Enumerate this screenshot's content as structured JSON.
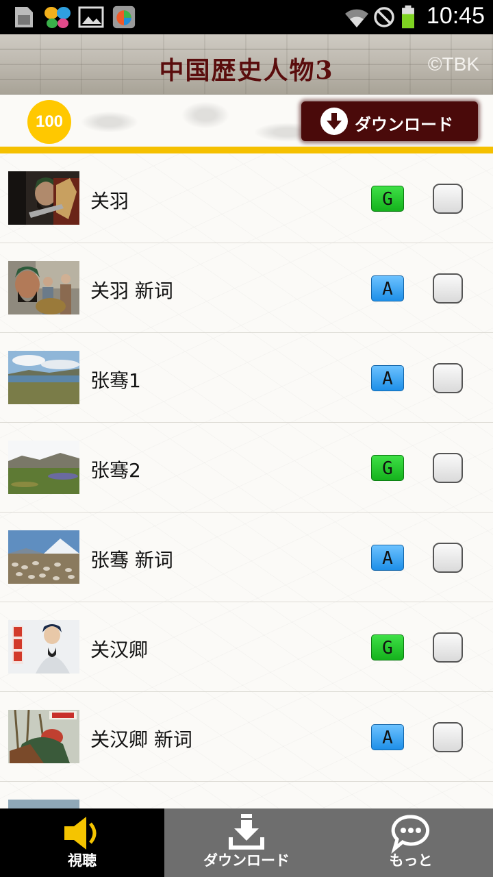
{
  "status_bar": {
    "time": "10:45",
    "icons": [
      "sd-card-icon",
      "butterfly-app-icon",
      "gallery-icon",
      "app-store-icon",
      "wifi-icon",
      "no-signal-icon",
      "battery-icon"
    ]
  },
  "header": {
    "title": "中国歴史人物3",
    "copyright": "©TBK"
  },
  "toolbar": {
    "score": "100",
    "download_label": "ダウンロード",
    "accent_color": "#f5c000"
  },
  "list": {
    "items": [
      {
        "title": "关羽",
        "tag": "G"
      },
      {
        "title": "关羽 新词",
        "tag": "A"
      },
      {
        "title": "张骞1",
        "tag": "A"
      },
      {
        "title": "张骞2",
        "tag": "G"
      },
      {
        "title": "张骞 新词",
        "tag": "A"
      },
      {
        "title": "关汉卿",
        "tag": "G"
      },
      {
        "title": "关汉卿 新词",
        "tag": "A"
      }
    ]
  },
  "bottom_nav": {
    "items": [
      {
        "label": "視聴",
        "icon": "speaker-icon",
        "active": true
      },
      {
        "label": "ダウンロード",
        "icon": "download-icon",
        "active": false
      },
      {
        "label": "もっと",
        "icon": "chat-bubble-icon",
        "active": false
      }
    ]
  }
}
